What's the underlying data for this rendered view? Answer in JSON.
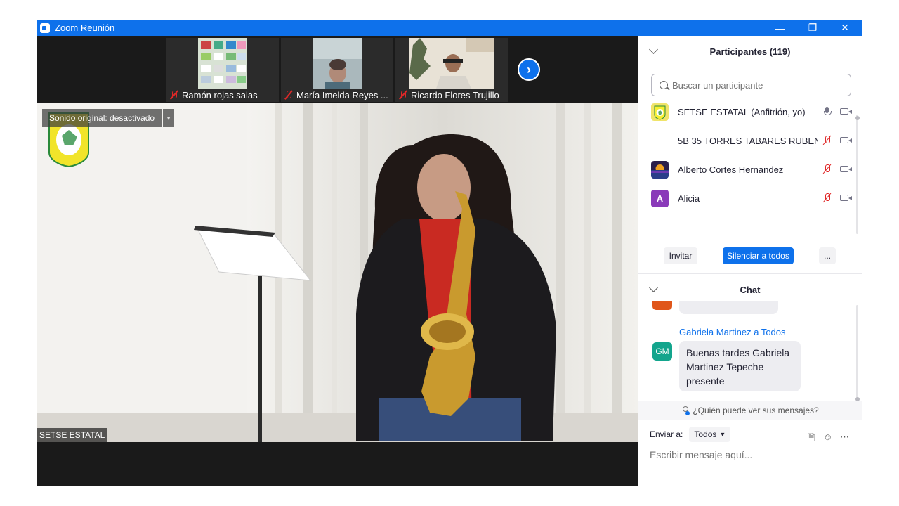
{
  "window": {
    "title": "Zoom Reunión"
  },
  "thumbnails": [
    {
      "name": "Ramón rojas salas"
    },
    {
      "name": "María Imelda Reyes ..."
    },
    {
      "name": "Ricardo Flores Trujillo"
    }
  ],
  "main_video": {
    "original_sound": "Sonido original: desactivado",
    "name_tag": "SETSE ESTATAL"
  },
  "participants": {
    "header": "Participantes (119)",
    "search_placeholder": "Buscar un participante",
    "list": [
      {
        "name": "SETSE ESTATAL (Anfitrión, yo)",
        "avatar": "",
        "mic": "on"
      },
      {
        "name": "5B 35 TORRES TABARES RUBEN ...",
        "avatar": "",
        "mic": "muted"
      },
      {
        "name": "Alberto Cortes Hernandez",
        "avatar": "",
        "mic": "muted"
      },
      {
        "name": "Alicia",
        "avatar": "A",
        "mic": "muted"
      }
    ],
    "invite_label": "Invitar",
    "mute_all_label": "Silenciar a todos",
    "more_label": "..."
  },
  "chat": {
    "header": "Chat",
    "sender": "Gabriela Martinez a Todos",
    "avatar_initials": "GM",
    "message": "Buenas tardes Gabriela Martinez Tepeche presente",
    "who_can_see": "¿Quién puede ver sus mensajes?",
    "send_to_label": "Enviar a:",
    "send_to_value": "Todos",
    "input_placeholder": "Escribir mensaje aquí..."
  },
  "colors": {
    "accent": "#0e71eb",
    "muted_red": "#e02828",
    "chat_avatar": "#13a58d",
    "alicia_avatar": "#8a3ab9"
  }
}
